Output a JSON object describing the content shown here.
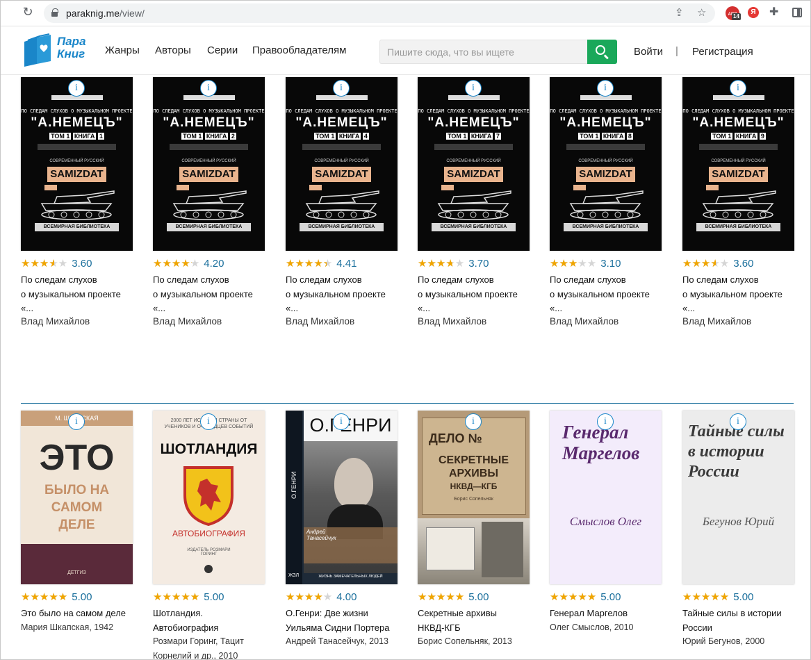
{
  "browser": {
    "url_host": "paraknig.me",
    "url_path": "/view/",
    "ext_badge": "14",
    "ext_abp": "ABP",
    "ext_ya": "Я"
  },
  "site": {
    "logo_line1": "Пара",
    "logo_line2": "Книг",
    "nav": [
      "Жанры",
      "Авторы",
      "Серии",
      "Правообладателям"
    ],
    "search_placeholder": "Пишите сюда, что вы ищете",
    "login": "Войти",
    "separator": "|",
    "register": "Регистрация"
  },
  "row1": [
    {
      "rating": 3.6,
      "score": "3.60",
      "title_lines": [
        "По следам слухов",
        "о музыкальном проекте",
        "«..."
      ],
      "author": "Влад Михайлов",
      "book_num": "1"
    },
    {
      "rating": 4.2,
      "score": "4.20",
      "title_lines": [
        "По следам слухов",
        "о музыкальном проекте",
        "«..."
      ],
      "author": "Влад Михайлов",
      "book_num": "2"
    },
    {
      "rating": 4.41,
      "score": "4.41",
      "title_lines": [
        "По следам слухов",
        "о музыкальном проекте",
        "«..."
      ],
      "author": "Влад Михайлов",
      "book_num": "4"
    },
    {
      "rating": 3.7,
      "score": "3.70",
      "title_lines": [
        "По следам слухов",
        "о музыкальном проекте",
        "«..."
      ],
      "author": "Влад Михайлов",
      "book_num": "7"
    },
    {
      "rating": 3.1,
      "score": "3.10",
      "title_lines": [
        "По следам слухов",
        "о музыкальном проекте",
        "«..."
      ],
      "author": "Влад Михайлов",
      "book_num": "8"
    },
    {
      "rating": 3.6,
      "score": "3.60",
      "title_lines": [
        "По следам слухов",
        "о музыкальном проекте",
        "«..."
      ],
      "author": "Влад Михайлов",
      "book_num": "9"
    }
  ],
  "samizdat_cover": {
    "line1": "ПО СЛЕДАМ СЛУХОВ О МУЗЫКАЛЬНОМ ПРОЕКТЕ",
    "big": "\"А.НЕМЕЦЪ\"",
    "tom": "ТОМ 1",
    "kniga": "КНИГА",
    "series": "СОВРЕМЕННЫЙ РУССКИЙ",
    "samizdat": "SAMIZDAT",
    "bottom": "ВСЕМИРНАЯ БИБЛИОТЕКА"
  },
  "row2": [
    {
      "rating": 5.0,
      "score": "5.00",
      "title_lines": [
        "Это было на самом деле"
      ],
      "meta_lines": [
        "Мария Шкапская, 1942"
      ]
    },
    {
      "rating": 5.0,
      "score": "5.00",
      "title_lines": [
        "Шотландия.",
        "Автобиография"
      ],
      "meta_lines": [
        "Розмари Горинг, Тацит",
        "Корнелий и др., 2010"
      ]
    },
    {
      "rating": 4.0,
      "score": "4.00",
      "title_lines": [
        "О.Генри: Две жизни",
        "Уильяма Сидни Портера"
      ],
      "meta_lines": [
        "Андрей Танасейчук, 2013"
      ]
    },
    {
      "rating": 5.0,
      "score": "5.00",
      "title_lines": [
        "Секретные архивы",
        "НКВД-КГБ"
      ],
      "meta_lines": [
        "Борис Сопельняк, 2013"
      ]
    },
    {
      "rating": 5.0,
      "score": "5.00",
      "title_lines": [
        "Генерал Маргелов"
      ],
      "meta_lines": [
        "Олег Смыслов, 2010"
      ]
    },
    {
      "rating": 5.0,
      "score": "5.00",
      "title_lines": [
        "Тайные силы в истории",
        "России"
      ],
      "meta_lines": [
        "Юрий Бегунов, 2000"
      ]
    }
  ],
  "covers2": {
    "eto": {
      "top": "М. ШКАПСКАЯ",
      "big": "ЭТО",
      "rest": "БЫЛО НА САМОМ ДЕЛЕ",
      "pub": "ДЕТГИЗ"
    },
    "shot": {
      "top": "2000 ЛЕТ ИСТОРИИ СТРАНЫ ОТ УЧЕНИКОВ И ОЧЕВИДЦЕВ СОБЫТИЙ",
      "big": "ШОТЛАНДИЯ",
      "sub": "АВТОБИОГРАФИЯ",
      "ed": "ИЗДАТЕЛЬ РОЗМАРИ ГОРИНГ"
    },
    "ogenri": {
      "big": "О.ГЕНРИ",
      "spine": "О.ГЕНРИ",
      "author": "Андрей Танасейчук",
      "series": "ЖИЗНЬ ЗАМЕЧАТЕЛЬНЫХ ЛЮДЕЙ",
      "zhzl": "ЖЗЛ"
    },
    "delo": {
      "top": "ДЕЛО №",
      "big": "СЕКРЕТНЫЕ АРХИВЫ",
      "sub": "НКВД—КГБ",
      "author": "Борис Сопельняк"
    },
    "gen": {
      "title": "Генерал Маргелов",
      "author": "Смыслов Олег"
    },
    "tain": {
      "title": "Тайные силы в истории России",
      "author": "Бегунов Юрий"
    }
  },
  "colors": {
    "accent": "#1a86c9",
    "search_button": "#1aa85a",
    "star": "#f0a500",
    "score": "#1a6f9c"
  }
}
